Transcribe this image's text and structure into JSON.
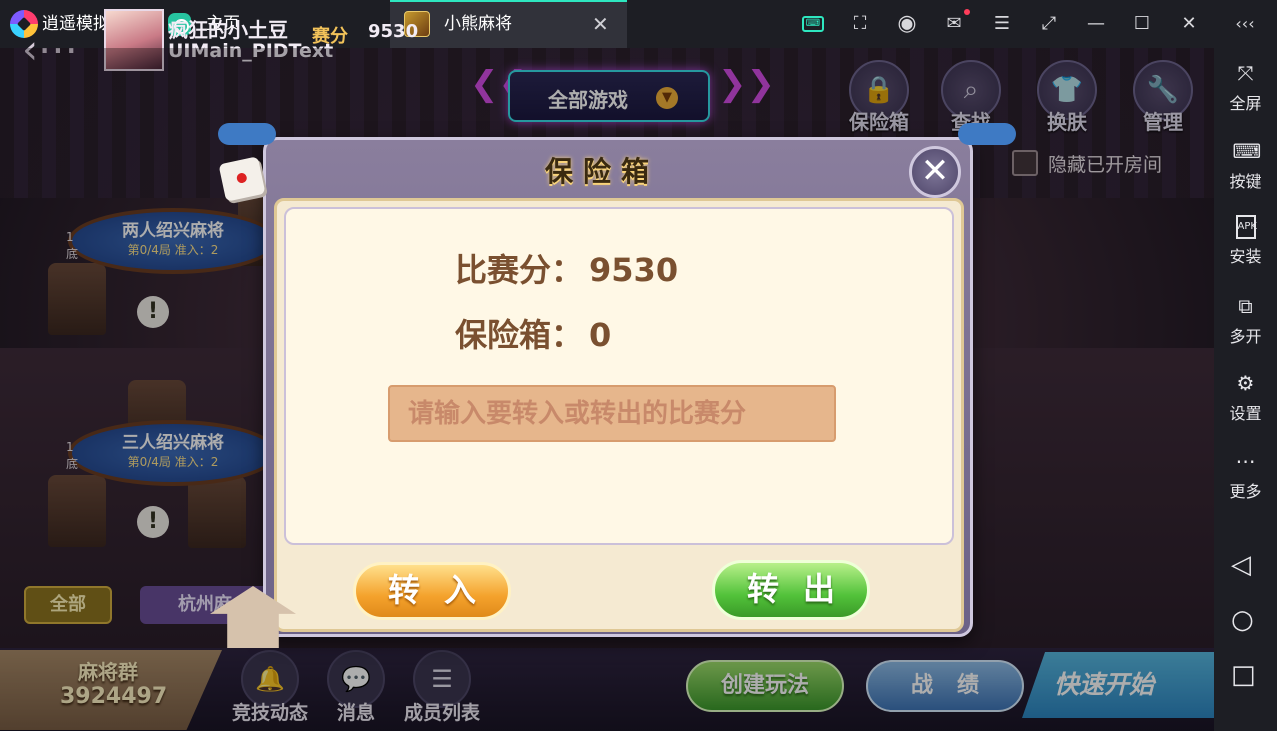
{
  "titlebar": {
    "app_name": "逍遥模拟器",
    "home_tab": "主页",
    "game_tab": "小熊麻将",
    "tab_close": "✕",
    "icons": [
      "keyboard-icon",
      "screenshot-icon",
      "account-icon",
      "mail-icon",
      "menu-icon",
      "pin-icon",
      "minimize-icon",
      "maximize-icon",
      "close-icon",
      "collapse-icon"
    ]
  },
  "sidebar": {
    "items": [
      {
        "label": "全屏",
        "icon": "fullscreen-icon"
      },
      {
        "label": "按键",
        "icon": "keyboard-icon"
      },
      {
        "label": "安装",
        "icon": "apk-icon"
      },
      {
        "label": "多开",
        "icon": "multi-instance-icon"
      },
      {
        "label": "设置",
        "icon": "gear-icon"
      },
      {
        "label": "更多",
        "icon": "more-icon"
      }
    ],
    "apk_text": "APK",
    "nav": [
      "back-triangle-icon",
      "home-circle-icon",
      "recent-square-icon"
    ]
  },
  "game": {
    "player": {
      "name": "疯狂的小土豆",
      "id": "UIMain_PIDText",
      "score_label": "赛分",
      "score": "9530"
    },
    "game_filter": "全部游戏",
    "top_buttons": [
      {
        "label": "保险箱",
        "icon": "lock-icon"
      },
      {
        "label": "查找",
        "icon": "search-icon"
      },
      {
        "label": "换肤",
        "icon": "shirt-icon"
      },
      {
        "label": "管理",
        "icon": "wrench-icon"
      }
    ],
    "hide_opened_label": "隐藏已开房间",
    "tables": [
      {
        "name": "两人绍兴麻将",
        "info": "第0/4局  准入：2",
        "side1": "1",
        "side2": "底"
      },
      {
        "name": "三人绍兴麻将",
        "info": "第0/4局  准入：2",
        "side1": "1",
        "side2": "底"
      }
    ],
    "filters": {
      "all": "全部",
      "hangzhou": "杭州麻"
    },
    "group": {
      "label": "麻将群",
      "number": "3924497"
    },
    "nav_buttons": [
      {
        "label": "竞技动态",
        "icon": "bell-icon"
      },
      {
        "label": "消息",
        "icon": "chat-icon"
      },
      {
        "label": "成员列表",
        "icon": "list-icon"
      }
    ],
    "create_label": "创建玩法",
    "record_label": "战绩",
    "quickstart_label": "快速开始"
  },
  "modal": {
    "title": "保险箱",
    "match_score_label": "比赛分：",
    "match_score_value": "9530",
    "safe_label": "保险箱：",
    "safe_value": "0",
    "input_placeholder": "请输入要转入或转出的比赛分",
    "transfer_in": "转入",
    "transfer_out": "转出",
    "close_symbol": "✕"
  },
  "colors": {
    "accent": "#2ee7c0",
    "gold_text": "#7a5030",
    "orange_button": "#f4a22c",
    "green_button": "#52c23a"
  }
}
